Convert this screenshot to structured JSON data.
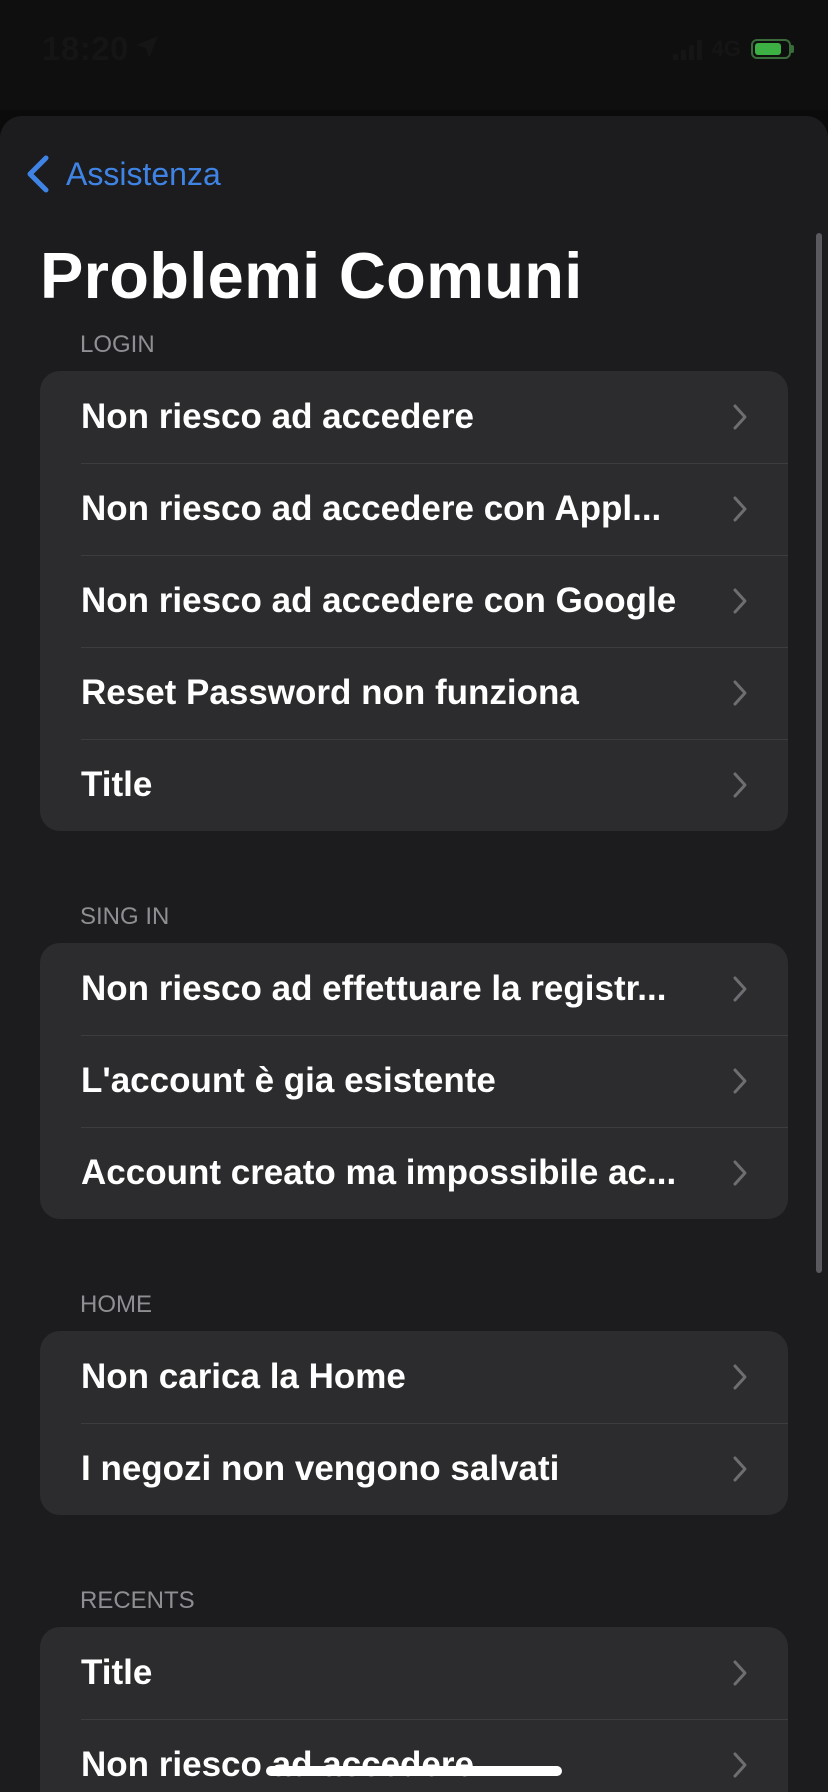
{
  "status_bar": {
    "time": "18:20",
    "network": "4G",
    "battery_level": 0.8,
    "location_icon": "location-arrow-icon"
  },
  "nav": {
    "back_label": "Assistenza",
    "back_icon": "chevron-left-icon"
  },
  "page_title": "Problemi Comuni",
  "accent_color": "#3f84e5",
  "sections": [
    {
      "header": "LOGIN",
      "rows": [
        "Non riesco ad accedere",
        "Non riesco ad accedere con Appl...",
        "Non riesco ad accedere con Google",
        "Reset Password non funziona",
        "Title"
      ]
    },
    {
      "header": "SING IN",
      "rows": [
        "Non riesco ad effettuare la registr...",
        "L'account è gia esistente",
        "Account creato ma impossibile ac..."
      ]
    },
    {
      "header": "HOME",
      "rows": [
        "Non carica la Home",
        "I negozi non vengono salvati"
      ]
    },
    {
      "header": "RECENTS",
      "rows": [
        "Title",
        "Non riesco ad accedere"
      ]
    }
  ]
}
